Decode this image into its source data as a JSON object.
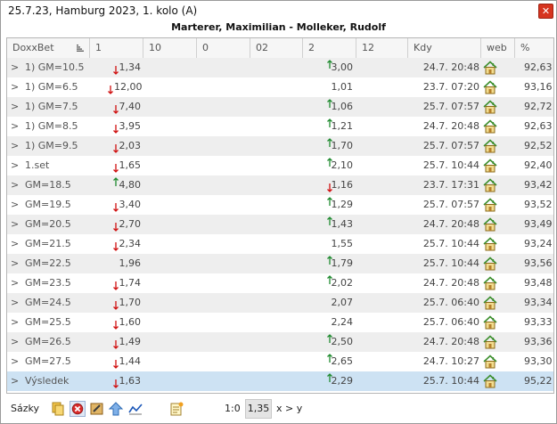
{
  "window": {
    "title": "25.7.23, Hamburg 2023, 1. kolo (A)",
    "close_glyph": "✕"
  },
  "match": {
    "players": "Marterer, Maximilian - Molleker, Rudolf"
  },
  "table": {
    "headers": [
      "DoxxBet",
      "1",
      "10",
      "0",
      "02",
      "2",
      "12",
      "Kdy",
      "web",
      "%"
    ],
    "rows": [
      {
        "expander": ">",
        "name": "1) GM=10.5",
        "odd1": "1,34",
        "arrow1": "down",
        "odd2": "3,00",
        "arrow2": "up",
        "kdy": "24.7. 20:48",
        "pct": "92,63"
      },
      {
        "expander": ">",
        "name": "1) GM=6.5",
        "odd1": "12,00",
        "arrow1": "down",
        "odd2": "1,01",
        "arrow2": "",
        "kdy": "23.7. 07:20",
        "pct": "93,16"
      },
      {
        "expander": ">",
        "name": "1) GM=7.5",
        "odd1": "7,40",
        "arrow1": "down",
        "odd2": "1,06",
        "arrow2": "up",
        "kdy": "25.7. 07:57",
        "pct": "92,72"
      },
      {
        "expander": ">",
        "name": "1) GM=8.5",
        "odd1": "3,95",
        "arrow1": "down",
        "odd2": "1,21",
        "arrow2": "up",
        "kdy": "24.7. 20:48",
        "pct": "92,63"
      },
      {
        "expander": ">",
        "name": "1) GM=9.5",
        "odd1": "2,03",
        "arrow1": "down",
        "odd2": "1,70",
        "arrow2": "up",
        "kdy": "25.7. 07:57",
        "pct": "92,52"
      },
      {
        "expander": ">",
        "name": "1.set",
        "odd1": "1,65",
        "arrow1": "down",
        "odd2": "2,10",
        "arrow2": "up",
        "kdy": "25.7. 10:44",
        "pct": "92,40"
      },
      {
        "expander": ">",
        "name": "GM=18.5",
        "odd1": "4,80",
        "arrow1": "up",
        "odd2": "1,16",
        "arrow2": "down",
        "kdy": "23.7. 17:31",
        "pct": "93,42"
      },
      {
        "expander": ">",
        "name": "GM=19.5",
        "odd1": "3,40",
        "arrow1": "down",
        "odd2": "1,29",
        "arrow2": "up",
        "kdy": "25.7. 07:57",
        "pct": "93,52"
      },
      {
        "expander": ">",
        "name": "GM=20.5",
        "odd1": "2,70",
        "arrow1": "down",
        "odd2": "1,43",
        "arrow2": "up",
        "kdy": "24.7. 20:48",
        "pct": "93,49"
      },
      {
        "expander": ">",
        "name": "GM=21.5",
        "odd1": "2,34",
        "arrow1": "down",
        "odd2": "1,55",
        "arrow2": "",
        "kdy": "25.7. 10:44",
        "pct": "93,24"
      },
      {
        "expander": ">",
        "name": "GM=22.5",
        "odd1": "1,96",
        "arrow1": "",
        "odd2": "1,79",
        "arrow2": "up",
        "kdy": "25.7. 10:44",
        "pct": "93,56"
      },
      {
        "expander": ">",
        "name": "GM=23.5",
        "odd1": "1,74",
        "arrow1": "down",
        "odd2": "2,02",
        "arrow2": "up",
        "kdy": "24.7. 20:48",
        "pct": "93,48"
      },
      {
        "expander": ">",
        "name": "GM=24.5",
        "odd1": "1,70",
        "arrow1": "down",
        "odd2": "2,07",
        "arrow2": "",
        "kdy": "25.7. 06:40",
        "pct": "93,34"
      },
      {
        "expander": ">",
        "name": "GM=25.5",
        "odd1": "1,60",
        "arrow1": "down",
        "odd2": "2,24",
        "arrow2": "",
        "kdy": "25.7. 06:40",
        "pct": "93,33"
      },
      {
        "expander": ">",
        "name": "GM=26.5",
        "odd1": "1,49",
        "arrow1": "down",
        "odd2": "2,50",
        "arrow2": "up",
        "kdy": "24.7. 20:48",
        "pct": "93,36"
      },
      {
        "expander": ">",
        "name": "GM=27.5",
        "odd1": "1,44",
        "arrow1": "down",
        "odd2": "2,65",
        "arrow2": "up",
        "kdy": "24.7. 10:27",
        "pct": "93,30"
      },
      {
        "expander": ">",
        "name": "Výsledek",
        "odd1": "1,63",
        "arrow1": "down",
        "odd2": "2,29",
        "arrow2": "up",
        "kdy": "25.7. 10:44",
        "pct": "95,22"
      }
    ],
    "selected_row": 16
  },
  "bottom": {
    "label": "Sázky",
    "score": "1:0",
    "odds": "1,35",
    "relation": "x > y",
    "icons": [
      "copy-icon",
      "delete-icon",
      "edit-icon",
      "up-arrow-icon",
      "chart-icon",
      "note-icon"
    ]
  },
  "colors": {
    "up_arrow": "#1e8a2e",
    "down_arrow": "#d01010",
    "selected_row": "#cde2f3",
    "alt_row": "#eeeeee"
  }
}
